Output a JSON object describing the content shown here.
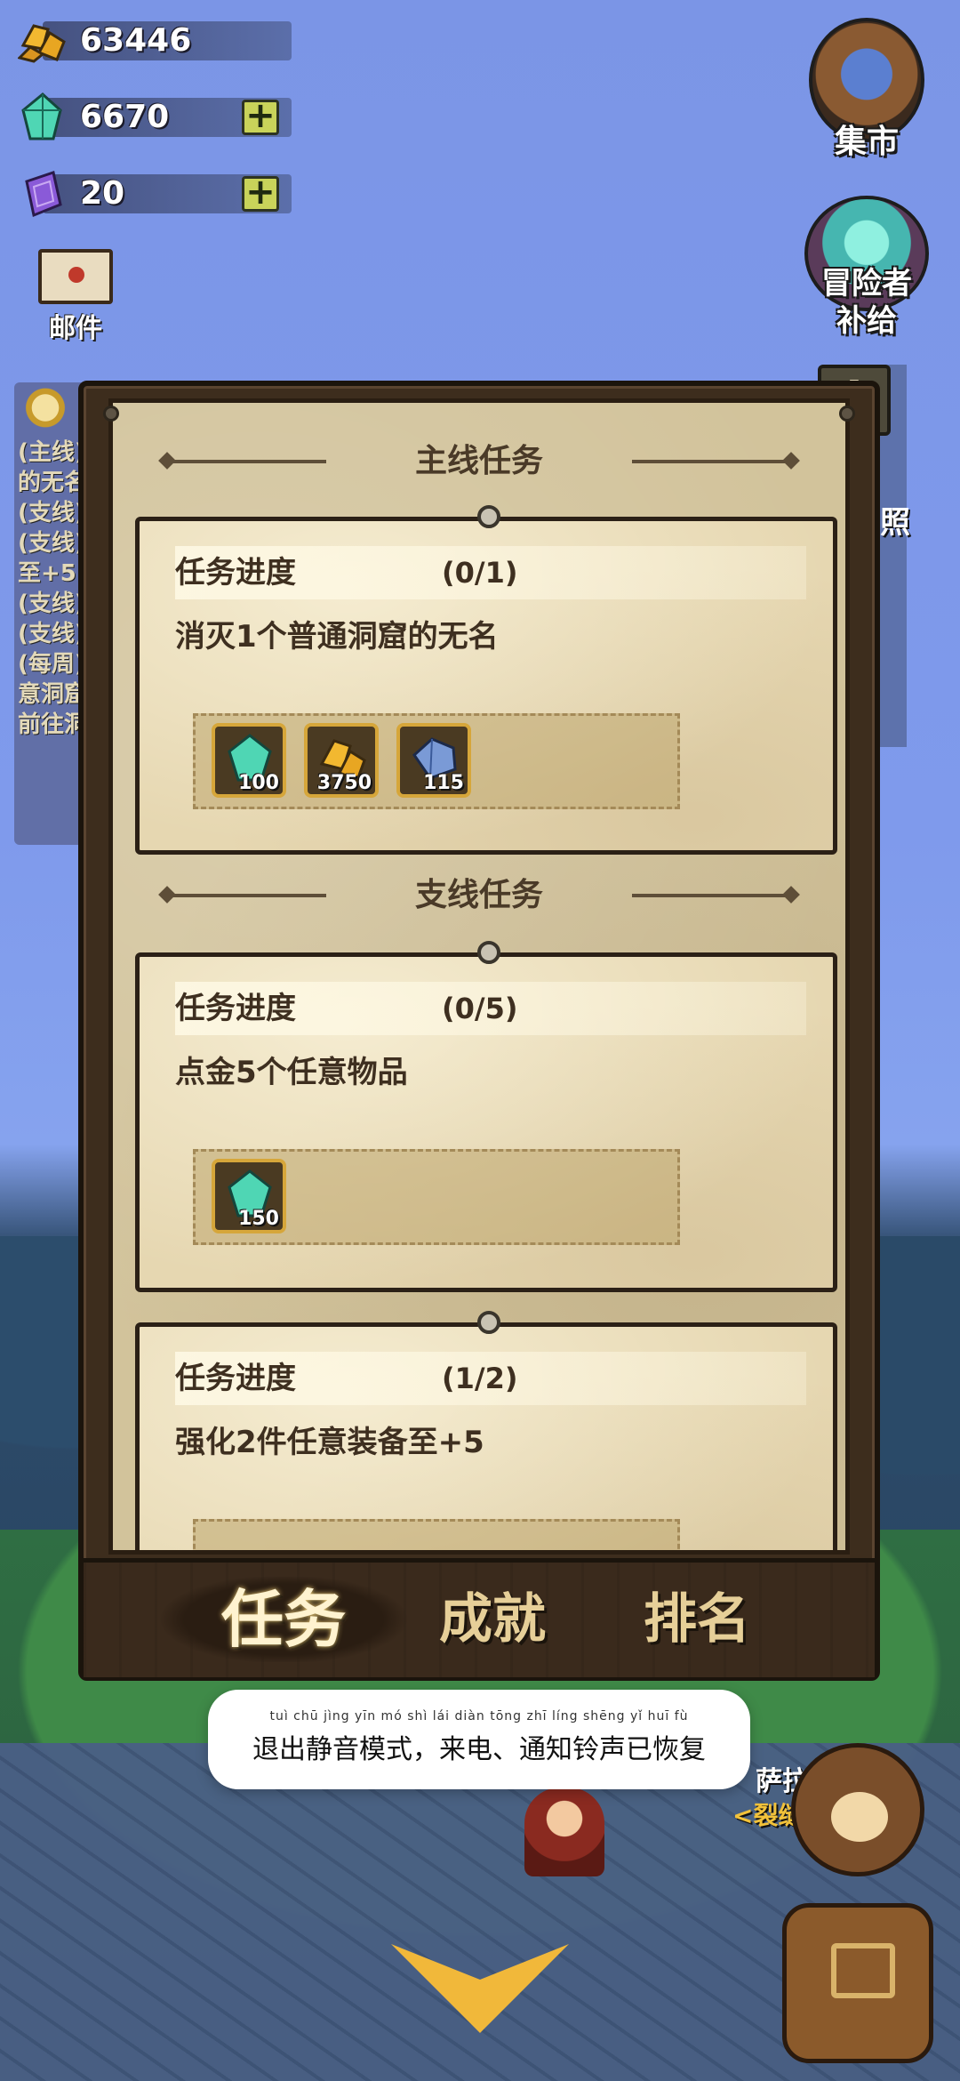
{
  "currencies": {
    "gold": {
      "value": "63446",
      "icon": "gold-ore-icon"
    },
    "crystal": {
      "value": "6670",
      "icon": "crystal-icon",
      "plus": "+"
    },
    "scroll": {
      "value": "20",
      "icon": "purple-scroll-icon",
      "plus": "+"
    }
  },
  "mail": {
    "label": "邮件"
  },
  "side_buttons": {
    "market": "集市",
    "supply": "冒险者\n补给",
    "alert": "!",
    "fragment": "照"
  },
  "tracker": {
    "rows": [
      "(主线)",
      "的无名",
      "(支线)",
      "(支线)",
      "至+5",
      "(支线)",
      "(支线)",
      "(每周)",
      "意洞窟",
      "前往洞"
    ]
  },
  "panel": {
    "main_title": "主线任务",
    "side_title": "支线任务",
    "quests": [
      {
        "progress_label": "任务进度",
        "progress_value": "(0/1)",
        "description": "消灭1个普通洞窟的无名",
        "rewards": [
          {
            "icon": "crystal-icon",
            "count": "100"
          },
          {
            "icon": "gold-ore-icon",
            "count": "3750"
          },
          {
            "icon": "iron-ore-icon",
            "count": "115"
          }
        ]
      },
      {
        "progress_label": "任务进度",
        "progress_value": "(0/5)",
        "description": "点金5个任意物品",
        "rewards": [
          {
            "icon": "crystal-icon",
            "count": "150"
          }
        ]
      },
      {
        "progress_label": "任务进度",
        "progress_value": "(1/2)",
        "description": "强化2件任意装备至+5",
        "rewards": []
      }
    ]
  },
  "tabs": [
    "任务",
    "成就",
    "排名"
  ],
  "toast": {
    "pinyin": "tuì chū jìng yīn mó shì   lái diàn  tōng zhī líng shēng yǐ huī fù",
    "text": "退出静音模式，来电、通知铃声已恢复"
  },
  "npc": {
    "name": "萨拉",
    "title": "<裂缝"
  },
  "colors": {
    "panel_bg": "#d2c39b",
    "frame": "#3d2d1d",
    "reward_border": "#d6a63a",
    "tab_text": "#e6cf98"
  }
}
